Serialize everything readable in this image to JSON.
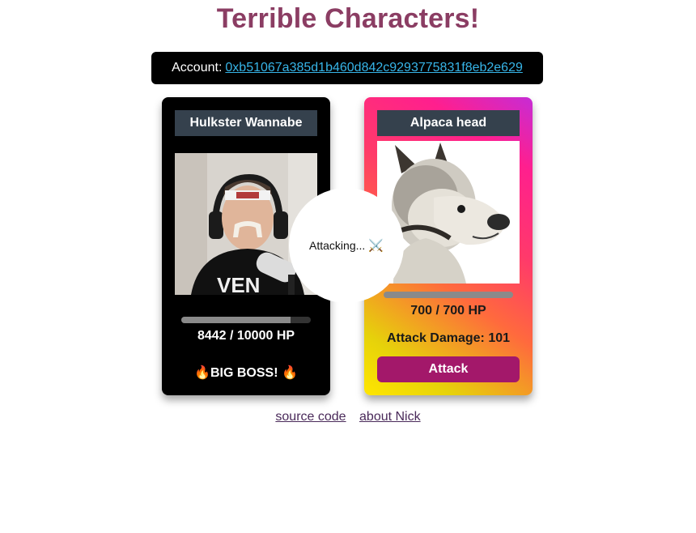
{
  "page": {
    "title": "Terrible Characters!"
  },
  "account": {
    "label": "Account:",
    "address": "0xb51067a385d1b460d842c9293775831f8eb2e629"
  },
  "player": {
    "name": "Hulkster Wannabe",
    "hp_text": "8442 / 10000 HP",
    "hp_fraction": 0.8442,
    "tag": "🔥BIG BOSS! 🔥"
  },
  "boss": {
    "name": "Alpaca head",
    "hp_text": "700 / 700 HP",
    "hp_fraction": 1.0,
    "damage_text": "Attack Damage: 101",
    "attack_label": "Attack"
  },
  "status": {
    "attacking_text": "Attacking...",
    "swords": "⚔️"
  },
  "footer": {
    "source_link": "source code",
    "about_link": "about Nick"
  },
  "colors": {
    "title": "#8b3d63",
    "link": "#37b5e8",
    "attack_button": "#a3186a",
    "name_bar": "#35414d"
  }
}
